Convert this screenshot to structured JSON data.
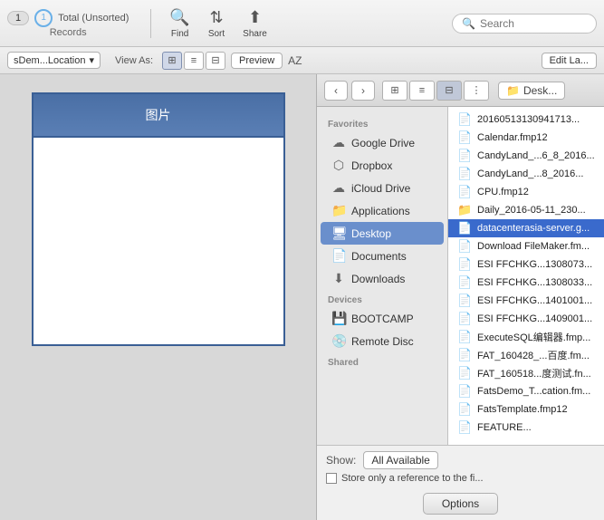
{
  "toolbar": {
    "records_count": "1",
    "total_label": "Total (Unsorted)",
    "records_label": "Records",
    "find_label": "Find",
    "sort_label": "Sort",
    "share_label": "Share",
    "search_placeholder": "Search"
  },
  "viewbar": {
    "dropdown_label": "sDem...Location",
    "view_as_label": "View As:",
    "preview_label": "Preview",
    "edit_label": "Edit La..."
  },
  "left_panel": {
    "image_label": "图片"
  },
  "file_dialog": {
    "location_label": "Desk...",
    "sidebar": {
      "favorites_label": "Favorites",
      "items": [
        {
          "id": "google-drive",
          "label": "Google Drive",
          "icon": "☁"
        },
        {
          "id": "dropbox",
          "label": "Dropbox",
          "icon": "📦"
        },
        {
          "id": "icloud-drive",
          "label": "iCloud Drive",
          "icon": "☁"
        },
        {
          "id": "applications",
          "label": "Applications",
          "icon": "📱"
        },
        {
          "id": "desktop",
          "label": "Desktop",
          "icon": "🖥",
          "active": true
        },
        {
          "id": "documents",
          "label": "Documents",
          "icon": "📄"
        },
        {
          "id": "downloads",
          "label": "Downloads",
          "icon": "⬇"
        }
      ],
      "devices_label": "Devices",
      "devices": [
        {
          "id": "bootcamp",
          "label": "BOOTCAMP",
          "icon": "💾"
        },
        {
          "id": "remote-disc",
          "label": "Remote Disc",
          "icon": "💿"
        }
      ],
      "shared_label": "Shared"
    },
    "files": [
      {
        "name": "20160513130941713...",
        "icon": "📄",
        "selected": false
      },
      {
        "name": "Calendar.fmp12",
        "icon": "📄",
        "selected": false
      },
      {
        "name": "CandyLand_...6_8_2016...",
        "icon": "📄",
        "selected": false
      },
      {
        "name": "CandyLand_...8_2016...",
        "icon": "📄",
        "selected": false
      },
      {
        "name": "CPU.fmp12",
        "icon": "📄",
        "selected": false
      },
      {
        "name": "Daily_2016-05-11_230...",
        "icon": "📁",
        "selected": false
      },
      {
        "name": "datacenterasia-server.g...",
        "icon": "📄",
        "selected": true
      },
      {
        "name": "Download FileMaker.fm...",
        "icon": "📄",
        "selected": false
      },
      {
        "name": "ESI FFCHKG...1308073...",
        "icon": "📄",
        "selected": false
      },
      {
        "name": "ESI FFCHKG...1308033...",
        "icon": "📄",
        "selected": false
      },
      {
        "name": "ESI FFCHKG...1401001...",
        "icon": "📄",
        "selected": false
      },
      {
        "name": "ESI FFCHKG...1409001...",
        "icon": "📄",
        "selected": false
      },
      {
        "name": "ExecuteSQL编辑器.fmp...",
        "icon": "📄",
        "selected": false
      },
      {
        "name": "FAT_160428_...百度.fm...",
        "icon": "📄",
        "selected": false
      },
      {
        "name": "FAT_160518...度测试.fn...",
        "icon": "📄",
        "selected": false
      },
      {
        "name": "FatsDemo_T...cation.fm...",
        "icon": "📄",
        "selected": false
      },
      {
        "name": "FatsTemplate.fmp12",
        "icon": "📄",
        "selected": false
      },
      {
        "name": "FEATURE...",
        "icon": "📄",
        "selected": false
      }
    ],
    "bottom": {
      "show_label": "Show:",
      "show_value": "All Available",
      "store_ref_label": "Store only a reference to the fi...",
      "options_label": "Options"
    }
  }
}
